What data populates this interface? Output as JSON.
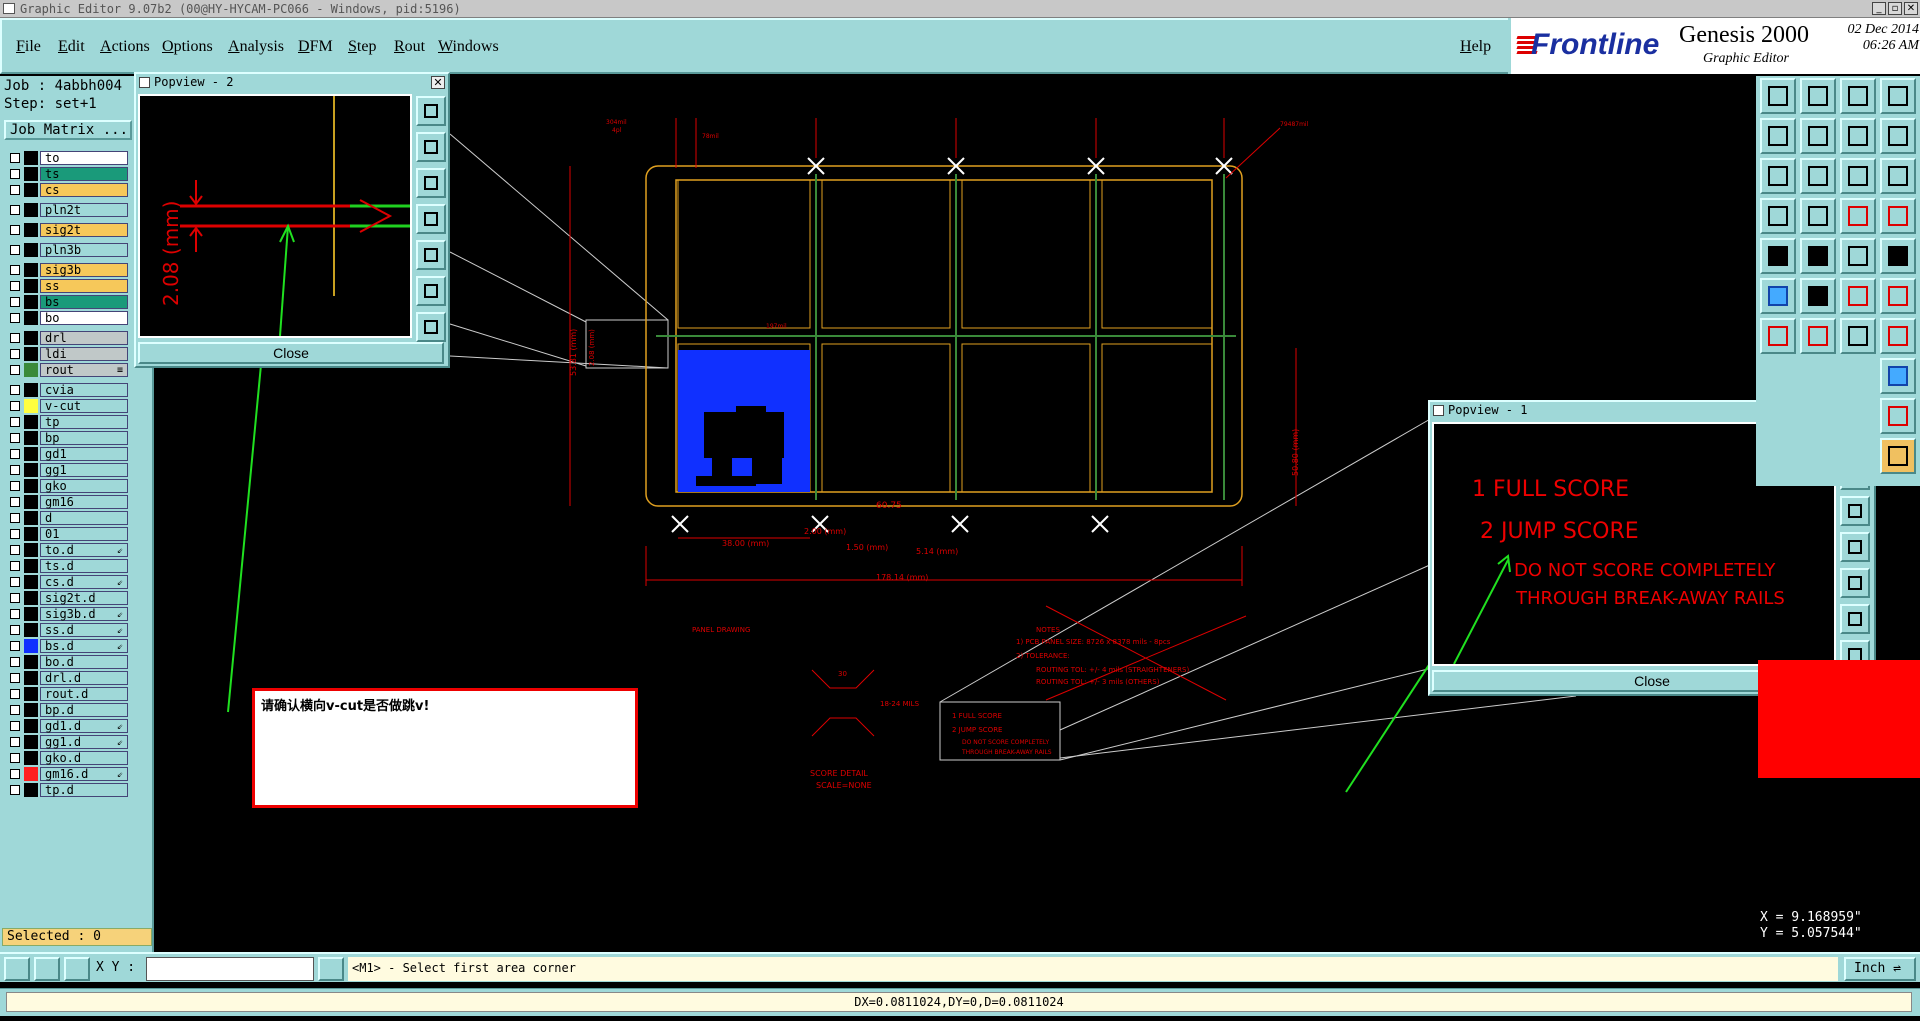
{
  "window": {
    "title": "Graphic Editor 9.07b2 (00@HY-HYCAM-PC066 - Windows, pid:5196)",
    "minimize": "_",
    "restore": "▫",
    "close": "✕"
  },
  "menu": [
    "File",
    "Edit",
    "Actions",
    "Options",
    "Analysis",
    "DFM",
    "Step",
    "Rout",
    "Windows"
  ],
  "help": "Help",
  "brand": {
    "logo": "Frontline",
    "product": "Genesis 2000",
    "subtitle": "Graphic Editor",
    "date": "02 Dec 2014",
    "time": "06:26 AM"
  },
  "left": {
    "job": "Job : 4abbh004",
    "step": "Step: set+1",
    "job_matrix": "Job Matrix ..."
  },
  "layers": [
    {
      "name": "to",
      "bg": "#ffffff",
      "swatch": "#000000",
      "mark": ""
    },
    {
      "name": "ts",
      "bg": "#1a9a7a",
      "swatch": "#000000",
      "mark": ""
    },
    {
      "name": "cs",
      "bg": "#f6c85a",
      "swatch": "#000000",
      "mark": ""
    },
    {
      "sep": true
    },
    {
      "name": "pln2t",
      "bg": "#9fd8d8",
      "swatch": "#000000",
      "mark": ""
    },
    {
      "sep": true
    },
    {
      "name": "sig2t",
      "bg": "#f6c85a",
      "swatch": "#000000",
      "mark": ""
    },
    {
      "sep": true
    },
    {
      "name": "pln3b",
      "bg": "#9fd8d8",
      "swatch": "#000000",
      "mark": ""
    },
    {
      "sep": true
    },
    {
      "name": "sig3b",
      "bg": "#f6c85a",
      "swatch": "#000000",
      "mark": ""
    },
    {
      "name": "ss",
      "bg": "#f6c85a",
      "swatch": "#000000",
      "mark": ""
    },
    {
      "name": "bs",
      "bg": "#1a9a7a",
      "swatch": "#000000",
      "mark": ""
    },
    {
      "name": "bo",
      "bg": "#ffffff",
      "swatch": "#000000",
      "mark": ""
    },
    {
      "sep": true
    },
    {
      "name": "drl",
      "bg": "#c0c8c8",
      "swatch": "#000000",
      "mark": ""
    },
    {
      "name": "ldi",
      "bg": "#c0c8c8",
      "swatch": "#000000",
      "mark": ""
    },
    {
      "name": "rout",
      "bg": "#c0c8c8",
      "swatch": "#3a8a3a",
      "mark": "≡"
    },
    {
      "sep": true
    },
    {
      "name": "cvia",
      "bg": "#9fd8d8",
      "swatch": "#000000",
      "mark": ""
    },
    {
      "name": "v-cut",
      "bg": "#9fd8d8",
      "swatch": "#ffff40",
      "mark": ""
    },
    {
      "name": "tp",
      "bg": "#9fd8d8",
      "swatch": "#000000",
      "mark": ""
    },
    {
      "name": "bp",
      "bg": "#9fd8d8",
      "swatch": "#000000",
      "mark": ""
    },
    {
      "name": "gd1",
      "bg": "#9fd8d8",
      "swatch": "#000000",
      "mark": ""
    },
    {
      "name": "gg1",
      "bg": "#9fd8d8",
      "swatch": "#000000",
      "mark": ""
    },
    {
      "name": "gko",
      "bg": "#9fd8d8",
      "swatch": "#000000",
      "mark": ""
    },
    {
      "name": "gm16",
      "bg": "#9fd8d8",
      "swatch": "#000000",
      "mark": ""
    },
    {
      "name": "d",
      "bg": "#9fd8d8",
      "swatch": "#000000",
      "mark": ""
    },
    {
      "name": "01",
      "bg": "#9fd8d8",
      "swatch": "#000000",
      "mark": ""
    },
    {
      "name": "to.d",
      "bg": "#9fd8d8",
      "swatch": "#000000",
      "mark": "⇙"
    },
    {
      "name": "ts.d",
      "bg": "#9fd8d8",
      "swatch": "#000000",
      "mark": ""
    },
    {
      "name": "cs.d",
      "bg": "#9fd8d8",
      "swatch": "#000000",
      "mark": "⇙"
    },
    {
      "name": "sig2t.d",
      "bg": "#9fd8d8",
      "swatch": "#000000",
      "mark": ""
    },
    {
      "name": "sig3b.d",
      "bg": "#9fd8d8",
      "swatch": "#000000",
      "mark": "⇙"
    },
    {
      "name": "ss.d",
      "bg": "#9fd8d8",
      "swatch": "#000000",
      "mark": "⇙"
    },
    {
      "name": "bs.d",
      "bg": "#9fd8d8",
      "swatch": "#1030ff",
      "mark": "⇙"
    },
    {
      "name": "bo.d",
      "bg": "#9fd8d8",
      "swatch": "#000000",
      "mark": ""
    },
    {
      "name": "drl.d",
      "bg": "#9fd8d8",
      "swatch": "#000000",
      "mark": ""
    },
    {
      "name": "rout.d",
      "bg": "#9fd8d8",
      "swatch": "#000000",
      "mark": ""
    },
    {
      "name": "bp.d",
      "bg": "#9fd8d8",
      "swatch": "#000000",
      "mark": ""
    },
    {
      "name": "gd1.d",
      "bg": "#9fd8d8",
      "swatch": "#000000",
      "mark": "⇙"
    },
    {
      "name": "gg1.d",
      "bg": "#9fd8d8",
      "swatch": "#000000",
      "mark": "⇙"
    },
    {
      "name": "gko.d",
      "bg": "#9fd8d8",
      "swatch": "#000000",
      "mark": ""
    },
    {
      "name": "gm16.d",
      "bg": "#9fd8d8",
      "swatch": "#ff2020",
      "mark": "⇙"
    },
    {
      "name": "tp.d",
      "bg": "#9fd8d8",
      "swatch": "#000000",
      "mark": ""
    }
  ],
  "selected": "Selected : 0",
  "popview2": {
    "title": "Popview - 2",
    "dim_label": "2.08 (mm)",
    "close": "Close"
  },
  "popview1": {
    "title": "Popview - 1",
    "line1": "1  FULL SCORE",
    "line2": "2 JUMP SCORE",
    "line3": "DO NOT SCORE COMPLETELY",
    "line4": "THROUGH BREAK-AWAY RAILS",
    "close": "Close"
  },
  "note": "请确认横向v-cut是否做跳v!",
  "drawing": {
    "dim_bottom": "178.14 (mm)",
    "dim_left": "38.00 (mm)",
    "dim_gap": "2.00 (mm)",
    "dim_small": "1.50 (mm)",
    "dim_mid": "5.14 (mm)",
    "dim_right": "50.80 (mm)",
    "dim_height": "53.81 (mm)",
    "dim_side": "2.08 (mm)",
    "angle": "60.75",
    "panel_label": "PANEL DRAWING",
    "score_detail": "SCORE DETAIL",
    "scale": "SCALE=NONE",
    "angle_label": "30",
    "mils": "18-24 MILS",
    "legend1": "1  FULL SCORE",
    "legend2": "2  JUMP SCORE",
    "legend3": "DO NOT SCORE COMPLETELY",
    "legend4": "THROUGH BREAK-AWAY RAILS",
    "notes_title": "NOTES",
    "notes1": "1)  PCB PANEL SIZE: 8726 x 8378 mils - 8pcs",
    "notes2": "2)  TOLERANCE:",
    "notes3": "ROUTING TOL: +/- 4 mils (STRAIGHTENERS)",
    "notes4": "ROUTING TOL: +/- 3 mils (OTHERS)",
    "top_label1": "304mil",
    "top_label2": "4pl",
    "top_label3": "78mil",
    "top_label4": "79487mil",
    "mid_label": "197mil"
  },
  "coords": {
    "x": "X = 9.168959\"",
    "y": "Y = 5.057544\""
  },
  "cmd": {
    "xy_label": "X Y :",
    "xy_value": "",
    "prompt": "<M1> - Select first area corner",
    "units": "Inch ⇌"
  },
  "status": "DX=0.0811024,DY=0,D=0.0811024"
}
